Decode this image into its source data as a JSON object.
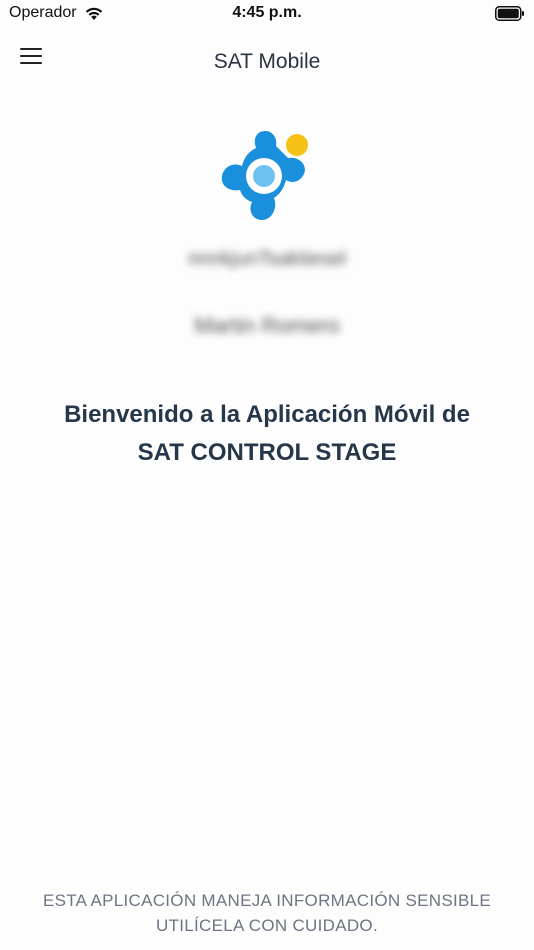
{
  "status_bar": {
    "carrier": "Operador",
    "time": "4:45 p.m.",
    "wifi_icon": "wifi-icon",
    "battery_icon": "battery-icon"
  },
  "nav": {
    "title": "SAT Mobile",
    "menu_icon": "hamburger-menu-icon"
  },
  "user": {
    "id": "nnnkjunTsaktiesel",
    "name": "Martin Romero"
  },
  "welcome": {
    "line1": "Bienvenido a la Aplicación Móvil de",
    "line2": "SAT CONTROL STAGE"
  },
  "footer": {
    "line1": "ESTA APLICACIÓN MANEJA INFORMACIÓN SENSIBLE",
    "line2": "UTILÍCELA CON CUIDADO."
  },
  "colors": {
    "brand_blue": "#1a8fdc",
    "brand_light_blue": "#6cc2ee",
    "brand_yellow": "#f5c117",
    "heading": "#26374a",
    "footer_text": "#6e7582"
  }
}
